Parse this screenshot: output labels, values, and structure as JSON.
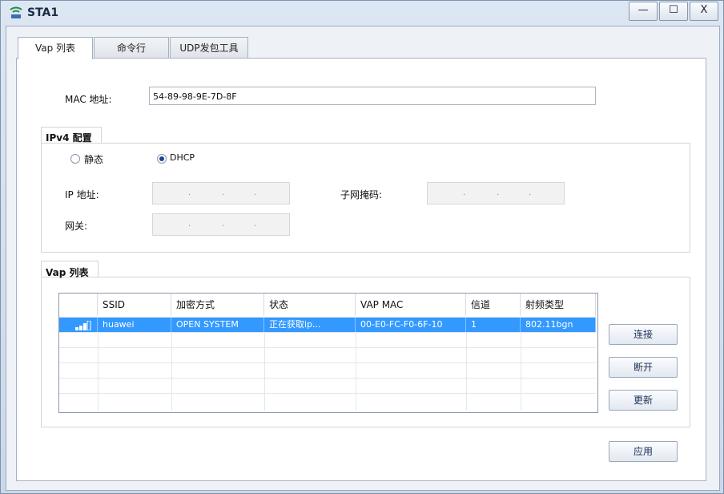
{
  "window": {
    "title": "STA1",
    "minimize": "—",
    "maximize": "☐",
    "close": "X"
  },
  "tabs": [
    {
      "label": "Vap 列表",
      "active": true
    },
    {
      "label": "命令行",
      "active": false
    },
    {
      "label": "UDP发包工具",
      "active": false
    }
  ],
  "mac": {
    "label": "MAC 地址:",
    "value": "54-89-98-9E-7D-8F"
  },
  "ipv4": {
    "title": "IPv4 配置",
    "mode_static": "静态",
    "mode_dhcp": "DHCP",
    "selected_mode": "DHCP",
    "ip_label": "IP 地址:",
    "mask_label": "子网掩码:",
    "gateway_label": "网关:"
  },
  "vap": {
    "title": "Vap 列表",
    "columns": [
      "",
      "SSID",
      "加密方式",
      "状态",
      "VAP MAC",
      "信道",
      "射频类型"
    ],
    "rows": [
      {
        "signal": "signal-icon",
        "ssid": "huawei",
        "encryption": "OPEN SYSTEM",
        "status": "正在获取ip...",
        "vap_mac": "00-E0-FC-F0-6F-10",
        "channel": "1",
        "radio_type": "802.11bgn",
        "selected": true
      }
    ],
    "buttons": {
      "connect": "连接",
      "disconnect": "断开",
      "update": "更新"
    }
  },
  "apply_label": "应用",
  "colors": {
    "selection": "#3399ff",
    "title_text": "#1b2a44",
    "frame": "#c9d6e5"
  }
}
